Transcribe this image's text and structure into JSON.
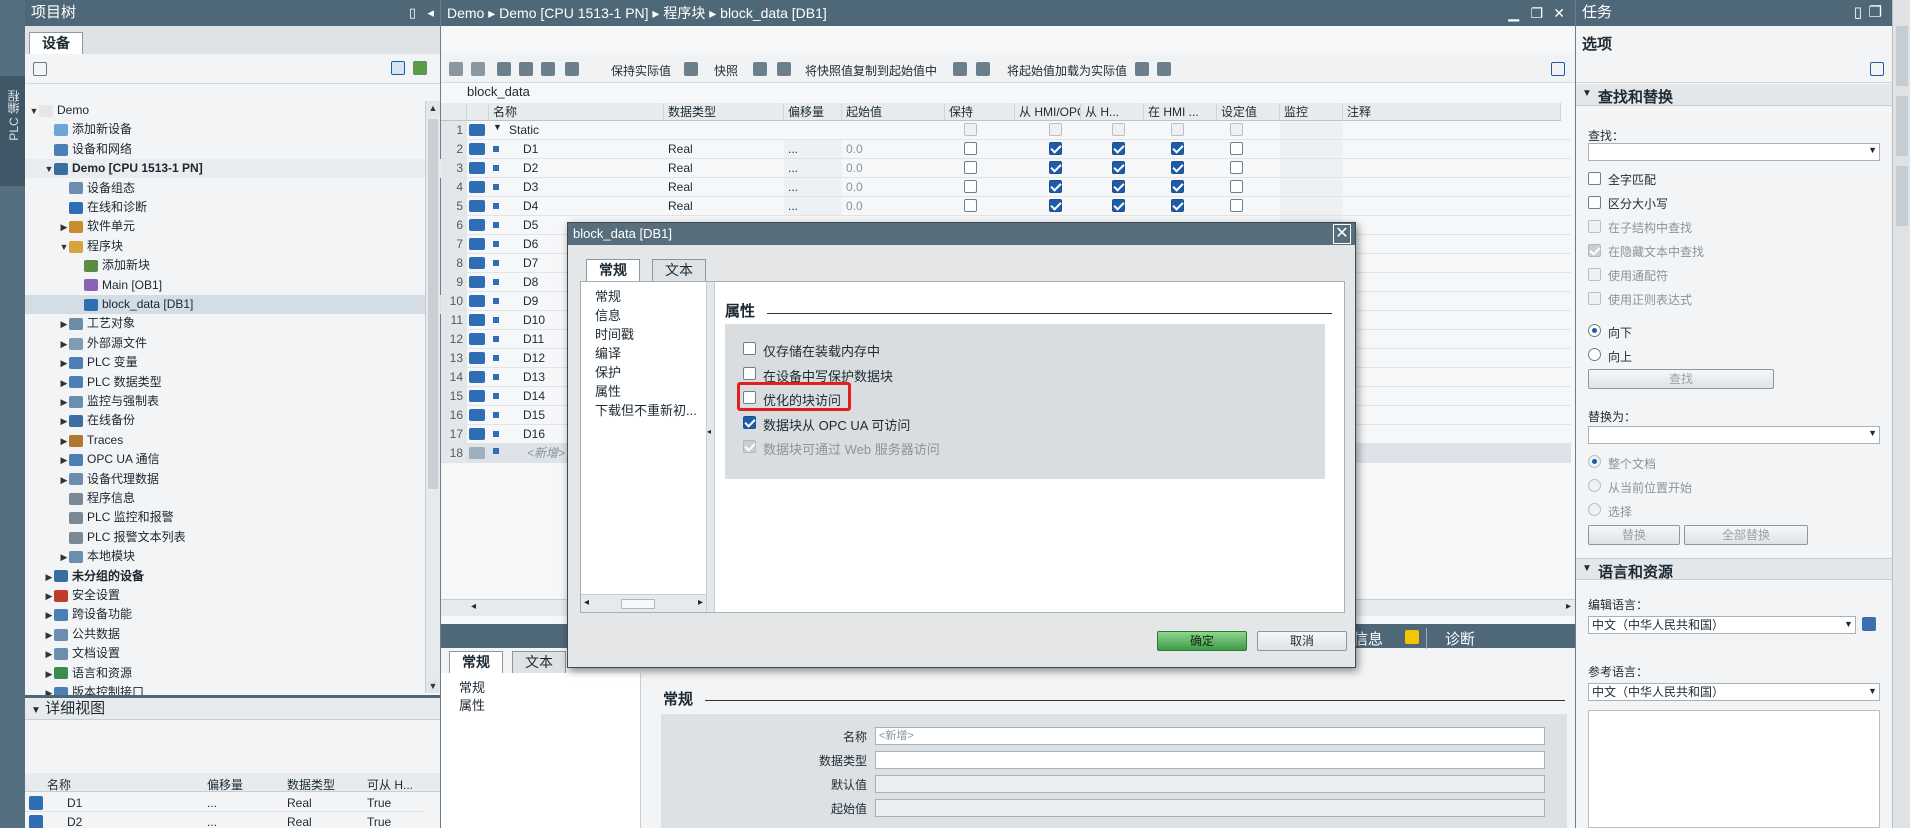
{
  "left_strip": {
    "label": "PLC 编程"
  },
  "project_tree": {
    "title": "项目树",
    "tab": "设备",
    "items": [
      {
        "label": "Demo",
        "indent": 0,
        "bold": false,
        "sel": false,
        "exp": "open"
      },
      {
        "label": "添加新设备",
        "indent": 1,
        "bold": false,
        "sel": false,
        "exp": ""
      },
      {
        "label": "设备和网络",
        "indent": 1,
        "bold": false,
        "sel": false,
        "exp": ""
      },
      {
        "label": "Demo [CPU 1513-1 PN]",
        "indent": 1,
        "bold": true,
        "sel": true,
        "exp": "open"
      },
      {
        "label": "设备组态",
        "indent": 2,
        "bold": false,
        "sel": false,
        "exp": ""
      },
      {
        "label": "在线和诊断",
        "indent": 2,
        "bold": false,
        "sel": false,
        "exp": ""
      },
      {
        "label": "软件单元",
        "indent": 2,
        "bold": false,
        "sel": false,
        "exp": "closed"
      },
      {
        "label": "程序块",
        "indent": 2,
        "bold": false,
        "sel": false,
        "exp": "open"
      },
      {
        "label": "添加新块",
        "indent": 3,
        "bold": false,
        "sel": false,
        "exp": ""
      },
      {
        "label": "Main [OB1]",
        "indent": 3,
        "bold": false,
        "sel": false,
        "exp": ""
      },
      {
        "label": "block_data [DB1]",
        "indent": 3,
        "bold": false,
        "sel": true,
        "exp": ""
      },
      {
        "label": "工艺对象",
        "indent": 2,
        "bold": false,
        "sel": false,
        "exp": "closed"
      },
      {
        "label": "外部源文件",
        "indent": 2,
        "bold": false,
        "sel": false,
        "exp": "closed"
      },
      {
        "label": "PLC 变量",
        "indent": 2,
        "bold": false,
        "sel": false,
        "exp": "closed"
      },
      {
        "label": "PLC 数据类型",
        "indent": 2,
        "bold": false,
        "sel": false,
        "exp": "closed"
      },
      {
        "label": "监控与强制表",
        "indent": 2,
        "bold": false,
        "sel": false,
        "exp": "closed"
      },
      {
        "label": "在线备份",
        "indent": 2,
        "bold": false,
        "sel": false,
        "exp": "closed"
      },
      {
        "label": "Traces",
        "indent": 2,
        "bold": false,
        "sel": false,
        "exp": "closed"
      },
      {
        "label": "OPC UA 通信",
        "indent": 2,
        "bold": false,
        "sel": false,
        "exp": "closed"
      },
      {
        "label": "设备代理数据",
        "indent": 2,
        "bold": false,
        "sel": false,
        "exp": "closed"
      },
      {
        "label": "程序信息",
        "indent": 2,
        "bold": false,
        "sel": false,
        "exp": ""
      },
      {
        "label": "PLC 监控和报警",
        "indent": 2,
        "bold": false,
        "sel": false,
        "exp": ""
      },
      {
        "label": "PLC 报警文本列表",
        "indent": 2,
        "bold": false,
        "sel": false,
        "exp": ""
      },
      {
        "label": "本地模块",
        "indent": 2,
        "bold": false,
        "sel": false,
        "exp": "closed"
      },
      {
        "label": "未分组的设备",
        "indent": 1,
        "bold": true,
        "sel": false,
        "exp": "closed"
      },
      {
        "label": "安全设置",
        "indent": 1,
        "bold": false,
        "sel": false,
        "exp": "closed"
      },
      {
        "label": "跨设备功能",
        "indent": 1,
        "bold": false,
        "sel": false,
        "exp": "closed"
      },
      {
        "label": "公共数据",
        "indent": 1,
        "bold": false,
        "sel": false,
        "exp": "closed"
      },
      {
        "label": "文档设置",
        "indent": 1,
        "bold": false,
        "sel": false,
        "exp": "closed"
      },
      {
        "label": "语言和资源",
        "indent": 1,
        "bold": false,
        "sel": false,
        "exp": "closed"
      },
      {
        "label": "版本控制接口",
        "indent": 1,
        "bold": false,
        "sel": false,
        "exp": "closed"
      }
    ]
  },
  "detail_view": {
    "title": "详细视图",
    "columns": [
      "名称",
      "偏移量",
      "数据类型",
      "可从 H..."
    ],
    "rows": [
      {
        "name": "D1",
        "offset": "...",
        "type": "Real",
        "hmi": "True"
      },
      {
        "name": "D2",
        "offset": "...",
        "type": "Real",
        "hmi": "True"
      }
    ]
  },
  "editor": {
    "breadcrumb": "Demo ▸ Demo [CPU 1513-1 PN] ▸ 程序块 ▸ block_data [DB1]",
    "toolbar": {
      "keep_actual": "保持实际值",
      "snapshot": "快照",
      "copy_snapshot": "将快照值复制到起始值中",
      "load_start": "将起始值加载为实际值"
    },
    "block_name": "block_data",
    "columns": [
      "名称",
      "数据类型",
      "偏移量",
      "起始值",
      "保持",
      "从 HMI/OPC...",
      "从 H...",
      "在 HMI ...",
      "设定值",
      "监控",
      "注释"
    ],
    "static_label": "Static",
    "new_row_label": "<新增>",
    "rows": [
      {
        "no": "1"
      },
      {
        "no": "2",
        "name": "D1",
        "type": "Real",
        "offset": "...",
        "start": "0.0"
      },
      {
        "no": "3",
        "name": "D2",
        "type": "Real",
        "offset": "...",
        "start": "0.0"
      },
      {
        "no": "4",
        "name": "D3",
        "type": "Real",
        "offset": "...",
        "start": "0.0"
      },
      {
        "no": "5",
        "name": "D4",
        "type": "Real",
        "offset": "...",
        "start": "0.0"
      },
      {
        "no": "6",
        "name": "D5"
      },
      {
        "no": "7",
        "name": "D6"
      },
      {
        "no": "8",
        "name": "D7"
      },
      {
        "no": "9",
        "name": "D8"
      },
      {
        "no": "10",
        "name": "D9"
      },
      {
        "no": "11",
        "name": "D10"
      },
      {
        "no": "12",
        "name": "D11"
      },
      {
        "no": "13",
        "name": "D12"
      },
      {
        "no": "14",
        "name": "D13"
      },
      {
        "no": "15",
        "name": "D14"
      },
      {
        "no": "16",
        "name": "D15"
      },
      {
        "no": "17",
        "name": "D16"
      },
      {
        "no": "18"
      }
    ]
  },
  "inspector": {
    "tabs": [
      "常规",
      "文本"
    ],
    "nav": [
      "常规",
      "属性"
    ],
    "section": "常规",
    "fields": [
      "名称",
      "数据类型",
      "默认值",
      "起始值"
    ],
    "name_placeholder": "<新增>",
    "info_tab": "信息",
    "diag_tab": "诊断"
  },
  "dialog": {
    "title": "block_data [DB1]",
    "tabs": [
      "常规",
      "文本"
    ],
    "nav": [
      "常规",
      "信息",
      "时间戳",
      "编译",
      "保护",
      "属性",
      "下载但不重新初..."
    ],
    "section": "属性",
    "options": [
      {
        "label": "仅存储在装载内存中",
        "state": "off"
      },
      {
        "label": "在设备中写保护数据块",
        "state": "off"
      },
      {
        "label": "优化的块访问",
        "state": "off"
      },
      {
        "label": "数据块从 OPC UA 可访问",
        "state": "on"
      },
      {
        "label": "数据块可通过 Web 服务器访问",
        "state": "dison"
      }
    ],
    "ok": "确定",
    "cancel": "取消"
  },
  "tasks": {
    "title": "任务",
    "options_label": "选项",
    "find_section": "查找和替换",
    "find_label": "查找：",
    "checks": [
      {
        "label": "全字匹配",
        "state": "off"
      },
      {
        "label": "区分大小写",
        "state": "off"
      },
      {
        "label": "在子结构中查找",
        "state": "dis"
      },
      {
        "label": "在隐藏文本中查找",
        "state": "dison"
      },
      {
        "label": "使用通配符",
        "state": "dis"
      },
      {
        "label": "使用正则表达式",
        "state": "dis"
      }
    ],
    "down": "向下",
    "up": "向上",
    "find_btn": "查找",
    "replace_label": "替换为：",
    "scope": [
      "整个文档",
      "从当前位置开始",
      "选择"
    ],
    "replace_btn": "替换",
    "replace_all_btn": "全部替换",
    "lang_section": "语言和资源",
    "edit_lang_label": "编辑语言：",
    "edit_lang": "中文（中华人民共和国）",
    "ref_lang_label": "参考语言：",
    "ref_lang": "中文（中华人民共和国）"
  },
  "colors": {
    "header": "#4f6878",
    "highlight": "#e0201c",
    "accent": "#1e5ca8",
    "ok_button": "#3f9a47"
  }
}
